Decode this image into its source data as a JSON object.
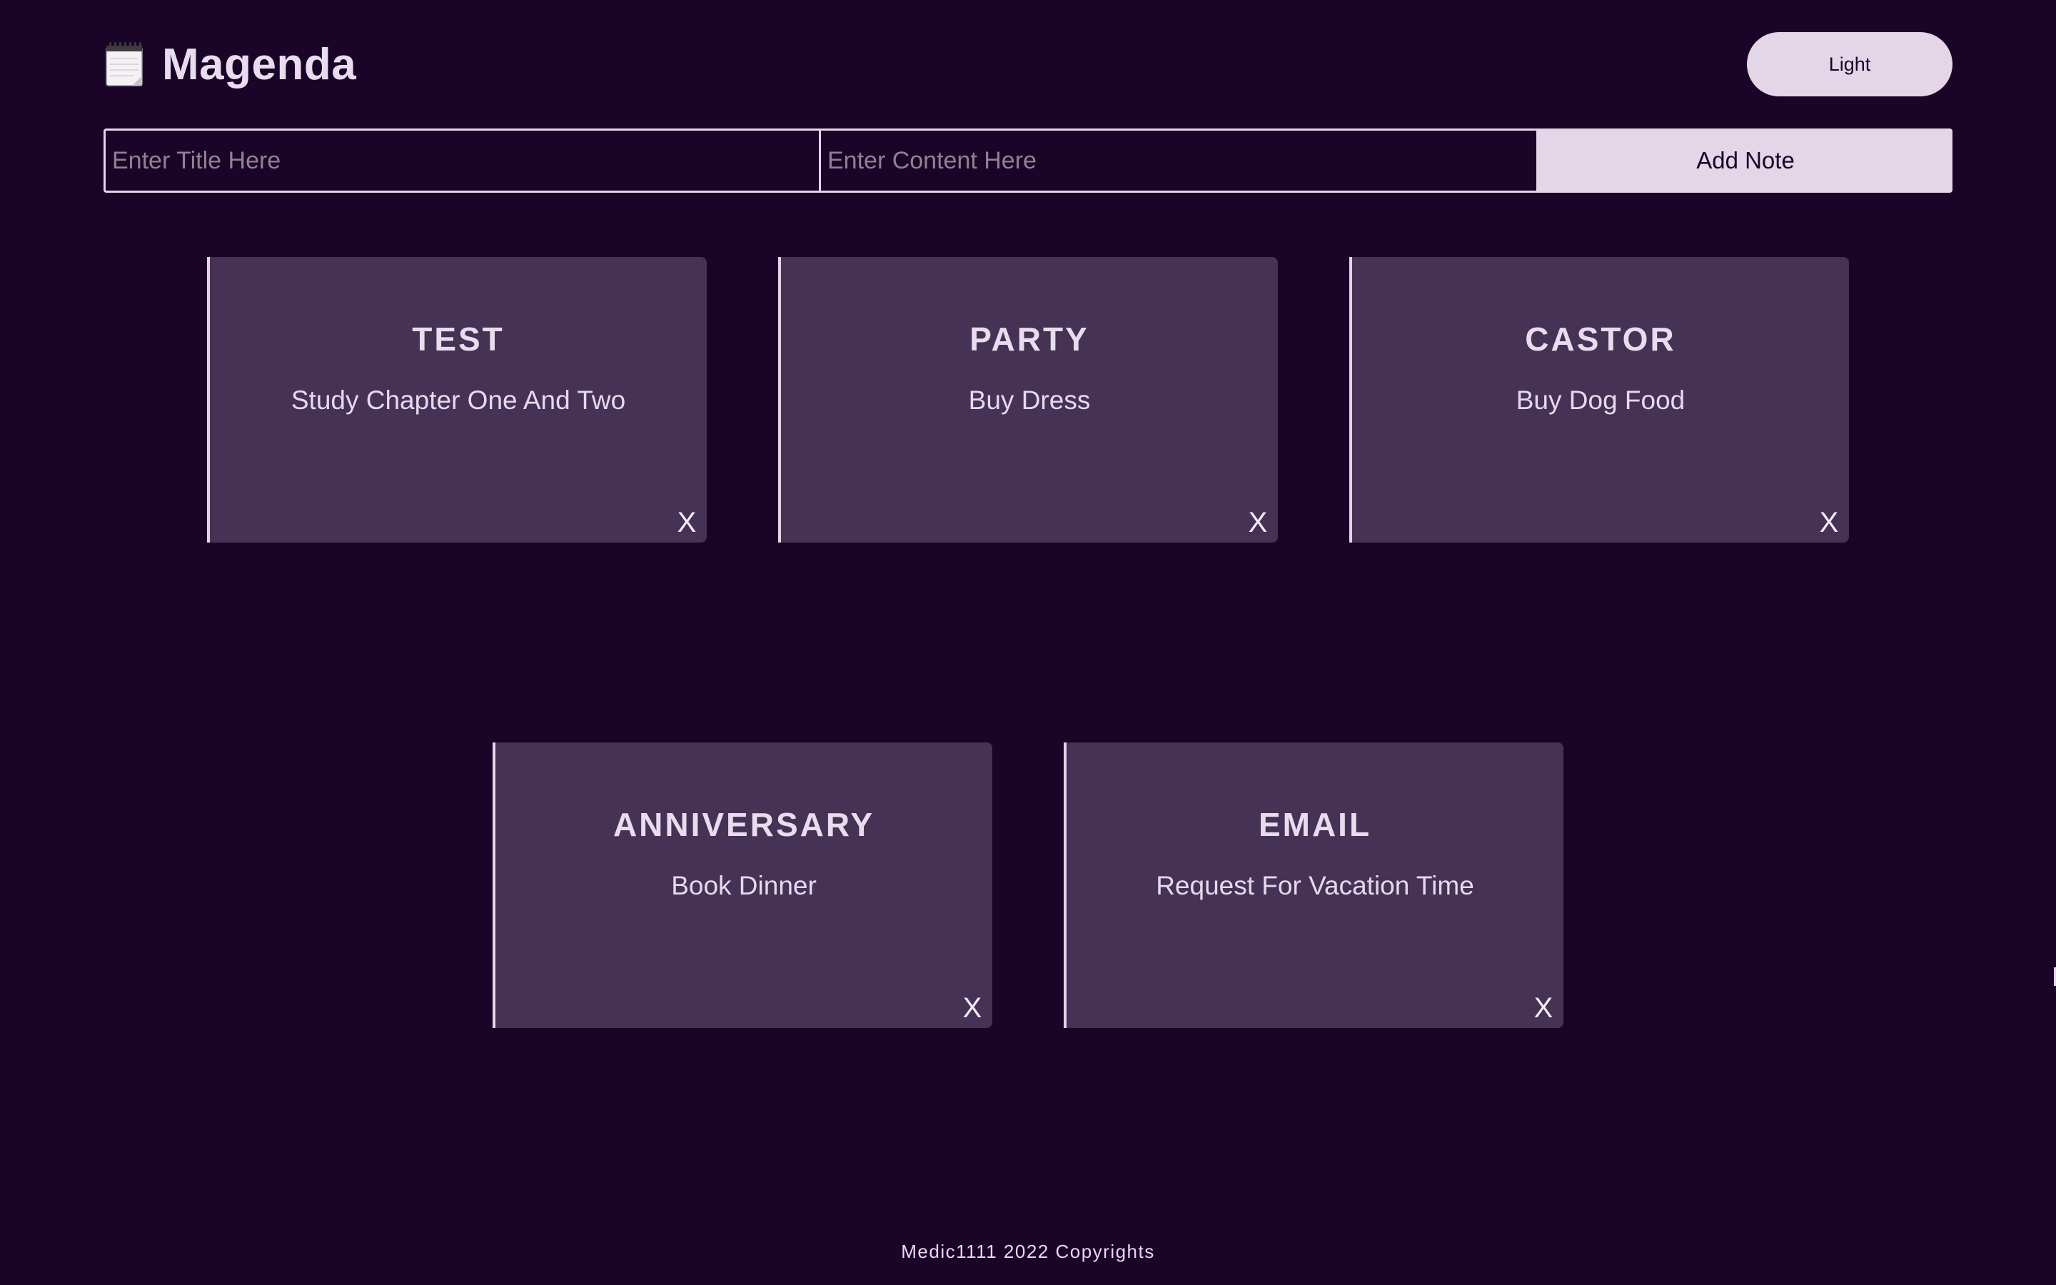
{
  "header": {
    "brand_title": "Magenda",
    "brand_icon": "notepad-icon",
    "theme_toggle_label": "Light"
  },
  "form": {
    "title_placeholder": "Enter Title Here",
    "content_placeholder": "Enter Content Here",
    "title_value": "",
    "content_value": "",
    "add_label": "Add Note"
  },
  "notes": [
    {
      "title": "TEST",
      "content": "Study Chapter One And Two",
      "delete_label": "X"
    },
    {
      "title": "PARTY",
      "content": "Buy Dress",
      "delete_label": "X"
    },
    {
      "title": "CASTOR",
      "content": "Buy Dog Food",
      "delete_label": "X"
    },
    {
      "title": "ANNIVERSARY",
      "content": "Book Dinner",
      "delete_label": "X"
    },
    {
      "title": "EMAIL",
      "content": "Request For Vacation Time",
      "delete_label": "X"
    }
  ],
  "footer": {
    "text": "Medic1111 2022 Copyrights"
  },
  "colors": {
    "background": "#1a0529",
    "card": "#453254",
    "accent": "#e2d6e7",
    "text": "#e6d9ee"
  }
}
